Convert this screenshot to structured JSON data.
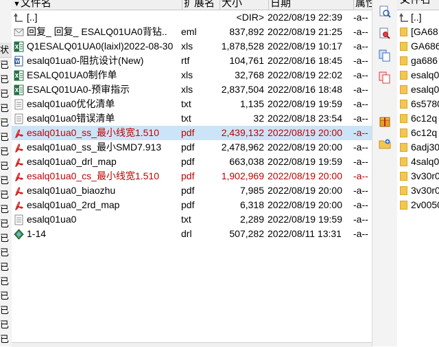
{
  "left_strip": {
    "tab_label": "状",
    "rows": [
      "已",
      "已",
      "已",
      "已",
      "已",
      "已",
      "已",
      "已",
      "已",
      "已",
      "已",
      "已",
      "已",
      "已",
      "已",
      "已",
      "已",
      "已",
      "已",
      "已",
      "已"
    ]
  },
  "columns": {
    "name": "文件名",
    "ext": "扩展名",
    "size": "大小",
    "date": "日期",
    "attr": "属性"
  },
  "files": [
    {
      "icon": "up-dir-icon",
      "name": "[..]",
      "ext": "",
      "size": "<DIR>",
      "date": "2022/08/19 22:39",
      "attr": "-a--",
      "red": false,
      "selected": false
    },
    {
      "icon": "email-file-icon",
      "name": "回复_ 回复_ ESALQ01UA0背钻..",
      "ext": "eml",
      "size": "837,892",
      "date": "2022/08/19 21:25",
      "attr": "-a--",
      "red": false,
      "selected": false
    },
    {
      "icon": "excel-file-icon",
      "name": "Q1ESALQ01UA0(laixl)2022-08-30",
      "ext": "xls",
      "size": "1,878,528",
      "date": "2022/08/19 10:17",
      "attr": "-a--",
      "red": false,
      "selected": false
    },
    {
      "icon": "rtf-file-icon",
      "name": "esalq01ua0-阻抗设计(New)",
      "ext": "rtf",
      "size": "104,761",
      "date": "2022/08/16 18:45",
      "attr": "-a--",
      "red": false,
      "selected": false
    },
    {
      "icon": "excel-file-icon",
      "name": "ESALQ01UA0制作单",
      "ext": "xls",
      "size": "32,768",
      "date": "2022/08/19 22:02",
      "attr": "-a--",
      "red": false,
      "selected": false
    },
    {
      "icon": "excel-file-icon",
      "name": "ESALQ01UA0-预审指示",
      "ext": "xls",
      "size": "2,837,504",
      "date": "2022/08/16 18:48",
      "attr": "-a--",
      "red": false,
      "selected": false
    },
    {
      "icon": "text-file-icon",
      "name": "esalq01ua0优化清单",
      "ext": "txt",
      "size": "1,135",
      "date": "2022/08/19 19:59",
      "attr": "-a--",
      "red": false,
      "selected": false
    },
    {
      "icon": "text-file-icon",
      "name": "esalq01ua0错误清单",
      "ext": "txt",
      "size": "32",
      "date": "2022/08/18 23:54",
      "attr": "-a--",
      "red": false,
      "selected": false
    },
    {
      "icon": "pdf-file-icon",
      "name": "esalq01ua0_ss_最小线宽1.510",
      "ext": "pdf",
      "size": "2,439,132",
      "date": "2022/08/19 20:00",
      "attr": "-a--",
      "red": true,
      "selected": true
    },
    {
      "icon": "pdf-file-icon",
      "name": "esalq01ua0_ss_最小SMD7.913",
      "ext": "pdf",
      "size": "2,478,962",
      "date": "2022/08/19 20:00",
      "attr": "-a--",
      "red": false,
      "selected": false
    },
    {
      "icon": "pdf-file-icon",
      "name": "esalq01ua0_drl_map",
      "ext": "pdf",
      "size": "663,038",
      "date": "2022/08/19 19:59",
      "attr": "-a--",
      "red": false,
      "selected": false
    },
    {
      "icon": "pdf-file-icon",
      "name": "esalq01ua0_cs_最小线宽1.510",
      "ext": "pdf",
      "size": "1,902,969",
      "date": "2022/08/19 20:00",
      "attr": "-a--",
      "red": true,
      "selected": false
    },
    {
      "icon": "pdf-file-icon",
      "name": "esalq01ua0_biaozhu",
      "ext": "pdf",
      "size": "7,985",
      "date": "2022/08/19 20:00",
      "attr": "-a--",
      "red": false,
      "selected": false
    },
    {
      "icon": "pdf-file-icon",
      "name": "esalq01ua0_2rd_map",
      "ext": "pdf",
      "size": "6,318",
      "date": "2022/08/19 20:00",
      "attr": "-a--",
      "red": false,
      "selected": false
    },
    {
      "icon": "text-file-icon",
      "name": "esalq01ua0",
      "ext": "txt",
      "size": "2,289",
      "date": "2022/08/19 19:59",
      "attr": "-a--",
      "red": false,
      "selected": false
    },
    {
      "icon": "drill-file-icon",
      "name": "1-14",
      "ext": "drl",
      "size": "507,282",
      "date": "2022/08/11 13:31",
      "attr": "-a--",
      "red": false,
      "selected": false
    }
  ],
  "toolbar": {
    "buttons": [
      "view-file-icon",
      "find-file-icon",
      "copy-file-icon",
      "delete-file-icon",
      "pack-icon",
      "new-folder-icon"
    ]
  },
  "right_panel": {
    "header": "文件名",
    "items": [
      "[..]",
      "[GA68",
      "GA686",
      "ga686",
      "esalq0",
      "esalq0",
      "6s5780",
      "6c12q",
      "6c12q",
      "6adj30",
      "4salq0",
      "3v30r0",
      "3v30r0",
      "2v0050"
    ]
  },
  "colors": {
    "selection": "#cce4f7",
    "highlight_text": "#c00000",
    "header_bg": "#f0f0f0",
    "folder": "#f3c650"
  }
}
